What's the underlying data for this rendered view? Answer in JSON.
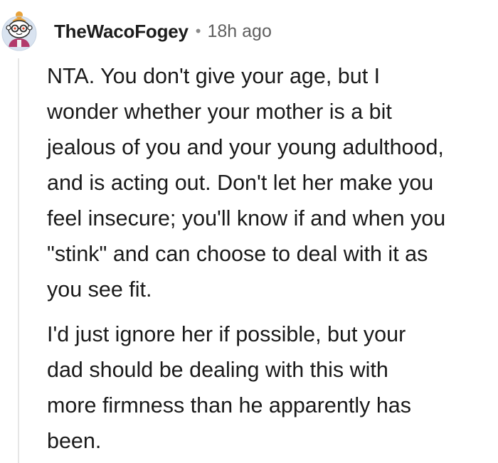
{
  "comment": {
    "author": "TheWacoFogey",
    "separator": "•",
    "timestamp": "18h ago",
    "avatar_icon": "snoo-avatar-icon",
    "paragraphs": [
      "NTA. You don't give your age, but I\nwonder whether your mother is a bit\njealous of you and your young adulthood,\nand is acting out. Don't let her make you\nfeel insecure; you'll know if and when you\n\"stink\" and can choose to deal with it as\nyou see fit.",
      "I'd just ignore her if possible, but your\ndad should be dealing with this with\nmore firmness than he apparently has\nbeen."
    ]
  },
  "colors": {
    "thread_line": "#e6e6e6",
    "text": "#1a1a1a",
    "meta": "#5f5f5f"
  }
}
